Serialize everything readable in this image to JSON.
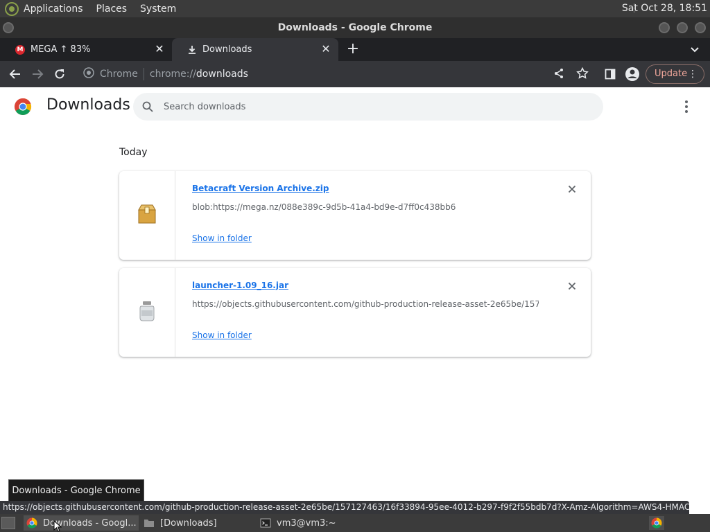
{
  "top_panel": {
    "menus": [
      "Applications",
      "Places",
      "System"
    ],
    "clock": "Sat Oct 28, 18:51"
  },
  "window": {
    "title": "Downloads - Google Chrome"
  },
  "tabs": [
    {
      "label": "MEGA ↑ 83%",
      "favicon": "mega-icon",
      "active": false
    },
    {
      "label": "Downloads",
      "favicon": "download-icon",
      "active": true
    }
  ],
  "toolbar": {
    "omnibox_chip": "Chrome",
    "url_scheme": "chrome://",
    "url_host": "downloads",
    "update_label": "Update"
  },
  "page": {
    "title": "Downloads",
    "search_placeholder": "Search downloads",
    "section": "Today",
    "downloads": [
      {
        "file_name": "Betacraft Version Archive.zip",
        "source": "blob:https://mega.nz/088e389c-9d5b-41a4-bd9e-d7ff0c438bb6",
        "action": "Show in folder",
        "icon": "archive-icon"
      },
      {
        "file_name": "launcher-1.09_16.jar",
        "source": "https://objects.githubusercontent.com/github-production-release-asset-2e65be/157...",
        "action": "Show in folder",
        "icon": "jar-icon"
      }
    ]
  },
  "tooltip": "Downloads - Google Chrome",
  "status_url": "https://objects.githubusercontent.com/github-production-release-asset-2e65be/157127463/16f33894-95ee-4012-b297-f9f2f55bdb7d?X-Amz-Algorithm=AWS4-HMAC-...",
  "taskbar": {
    "items": [
      {
        "label": "Downloads - Googl...",
        "icon": "chrome-icon"
      },
      {
        "label": "[Downloads]",
        "icon": "folder-icon"
      },
      {
        "label": "vm3@vm3:~",
        "icon": "terminal-icon"
      }
    ]
  },
  "colors": {
    "link": "#1a73e8",
    "toolbar_bg": "#35363a",
    "tabstrip_bg": "#202124",
    "update_text": "#f2a89c"
  }
}
